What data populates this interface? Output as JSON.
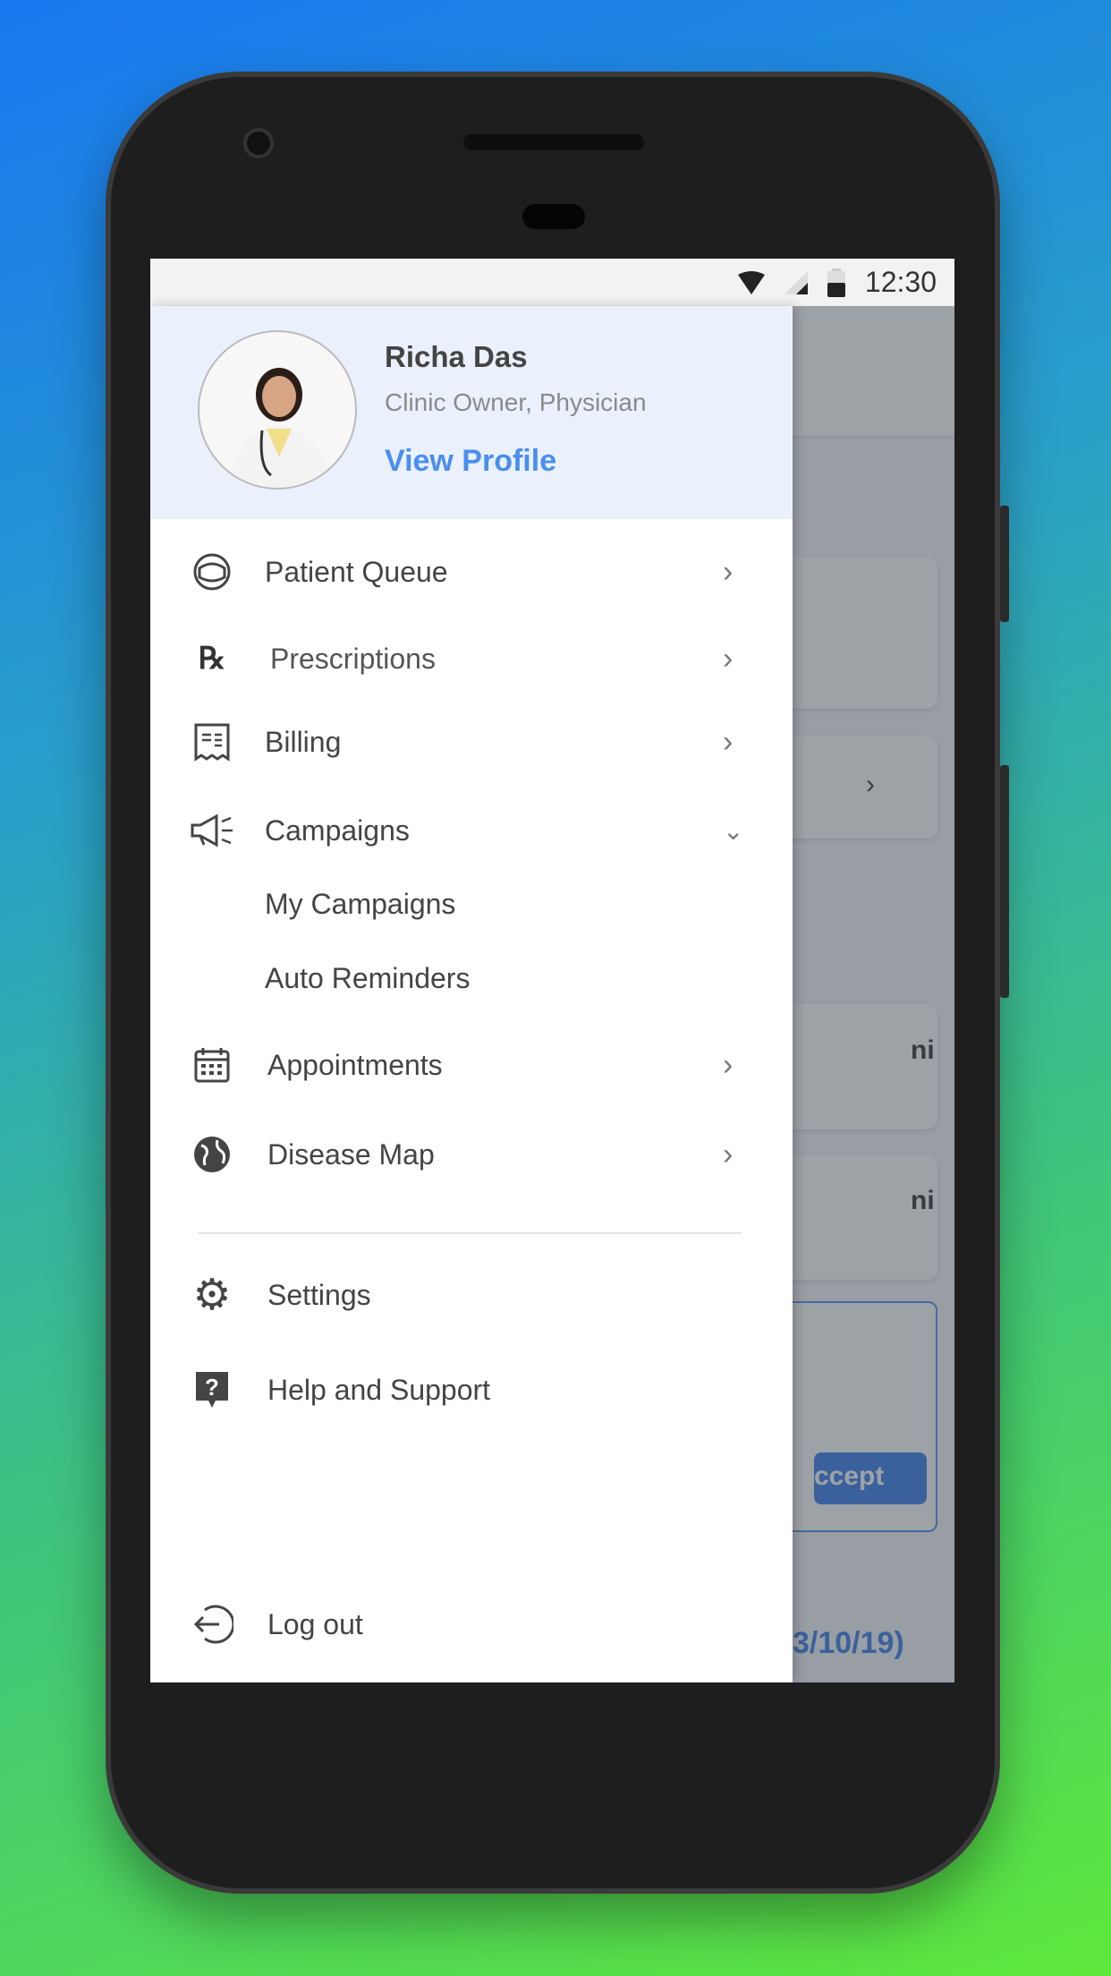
{
  "status_bar": {
    "time": "12:30",
    "icons": [
      "wifi-icon",
      "signal-icon",
      "battery-icon"
    ]
  },
  "profile": {
    "name": "Richa Das",
    "role": "Clinic Owner, Physician",
    "view_profile": "View Profile"
  },
  "menu": [
    {
      "label": "Patient Queue",
      "icon": "patient-queue-icon",
      "chevron": "right"
    },
    {
      "label": "Prescriptions",
      "icon": "rx-icon",
      "chevron": "right"
    },
    {
      "label": "Billing",
      "icon": "bill-icon",
      "chevron": "right"
    },
    {
      "label": "Campaigns",
      "icon": "megaphone-icon",
      "chevron": "down",
      "children": [
        "My Campaigns",
        "Auto Reminders"
      ]
    },
    {
      "label": "Appointments",
      "icon": "calendar-icon",
      "chevron": "right"
    },
    {
      "label": "Disease Map",
      "icon": "globe-icon",
      "chevron": "right"
    }
  ],
  "secondary": [
    {
      "label": "Settings",
      "icon": "gear-icon"
    },
    {
      "label": "Help and Support",
      "icon": "help-icon"
    }
  ],
  "logout": {
    "label": "Log out",
    "icon": "logout-icon"
  },
  "background_app": {
    "row_suffix_1": "ni",
    "row_suffix_2": "ni",
    "accept_label": "ccept",
    "date_fragment": "3/10/19)"
  },
  "colors": {
    "accent": "#4a8ef0",
    "header_bg": "#eaf1fd"
  }
}
